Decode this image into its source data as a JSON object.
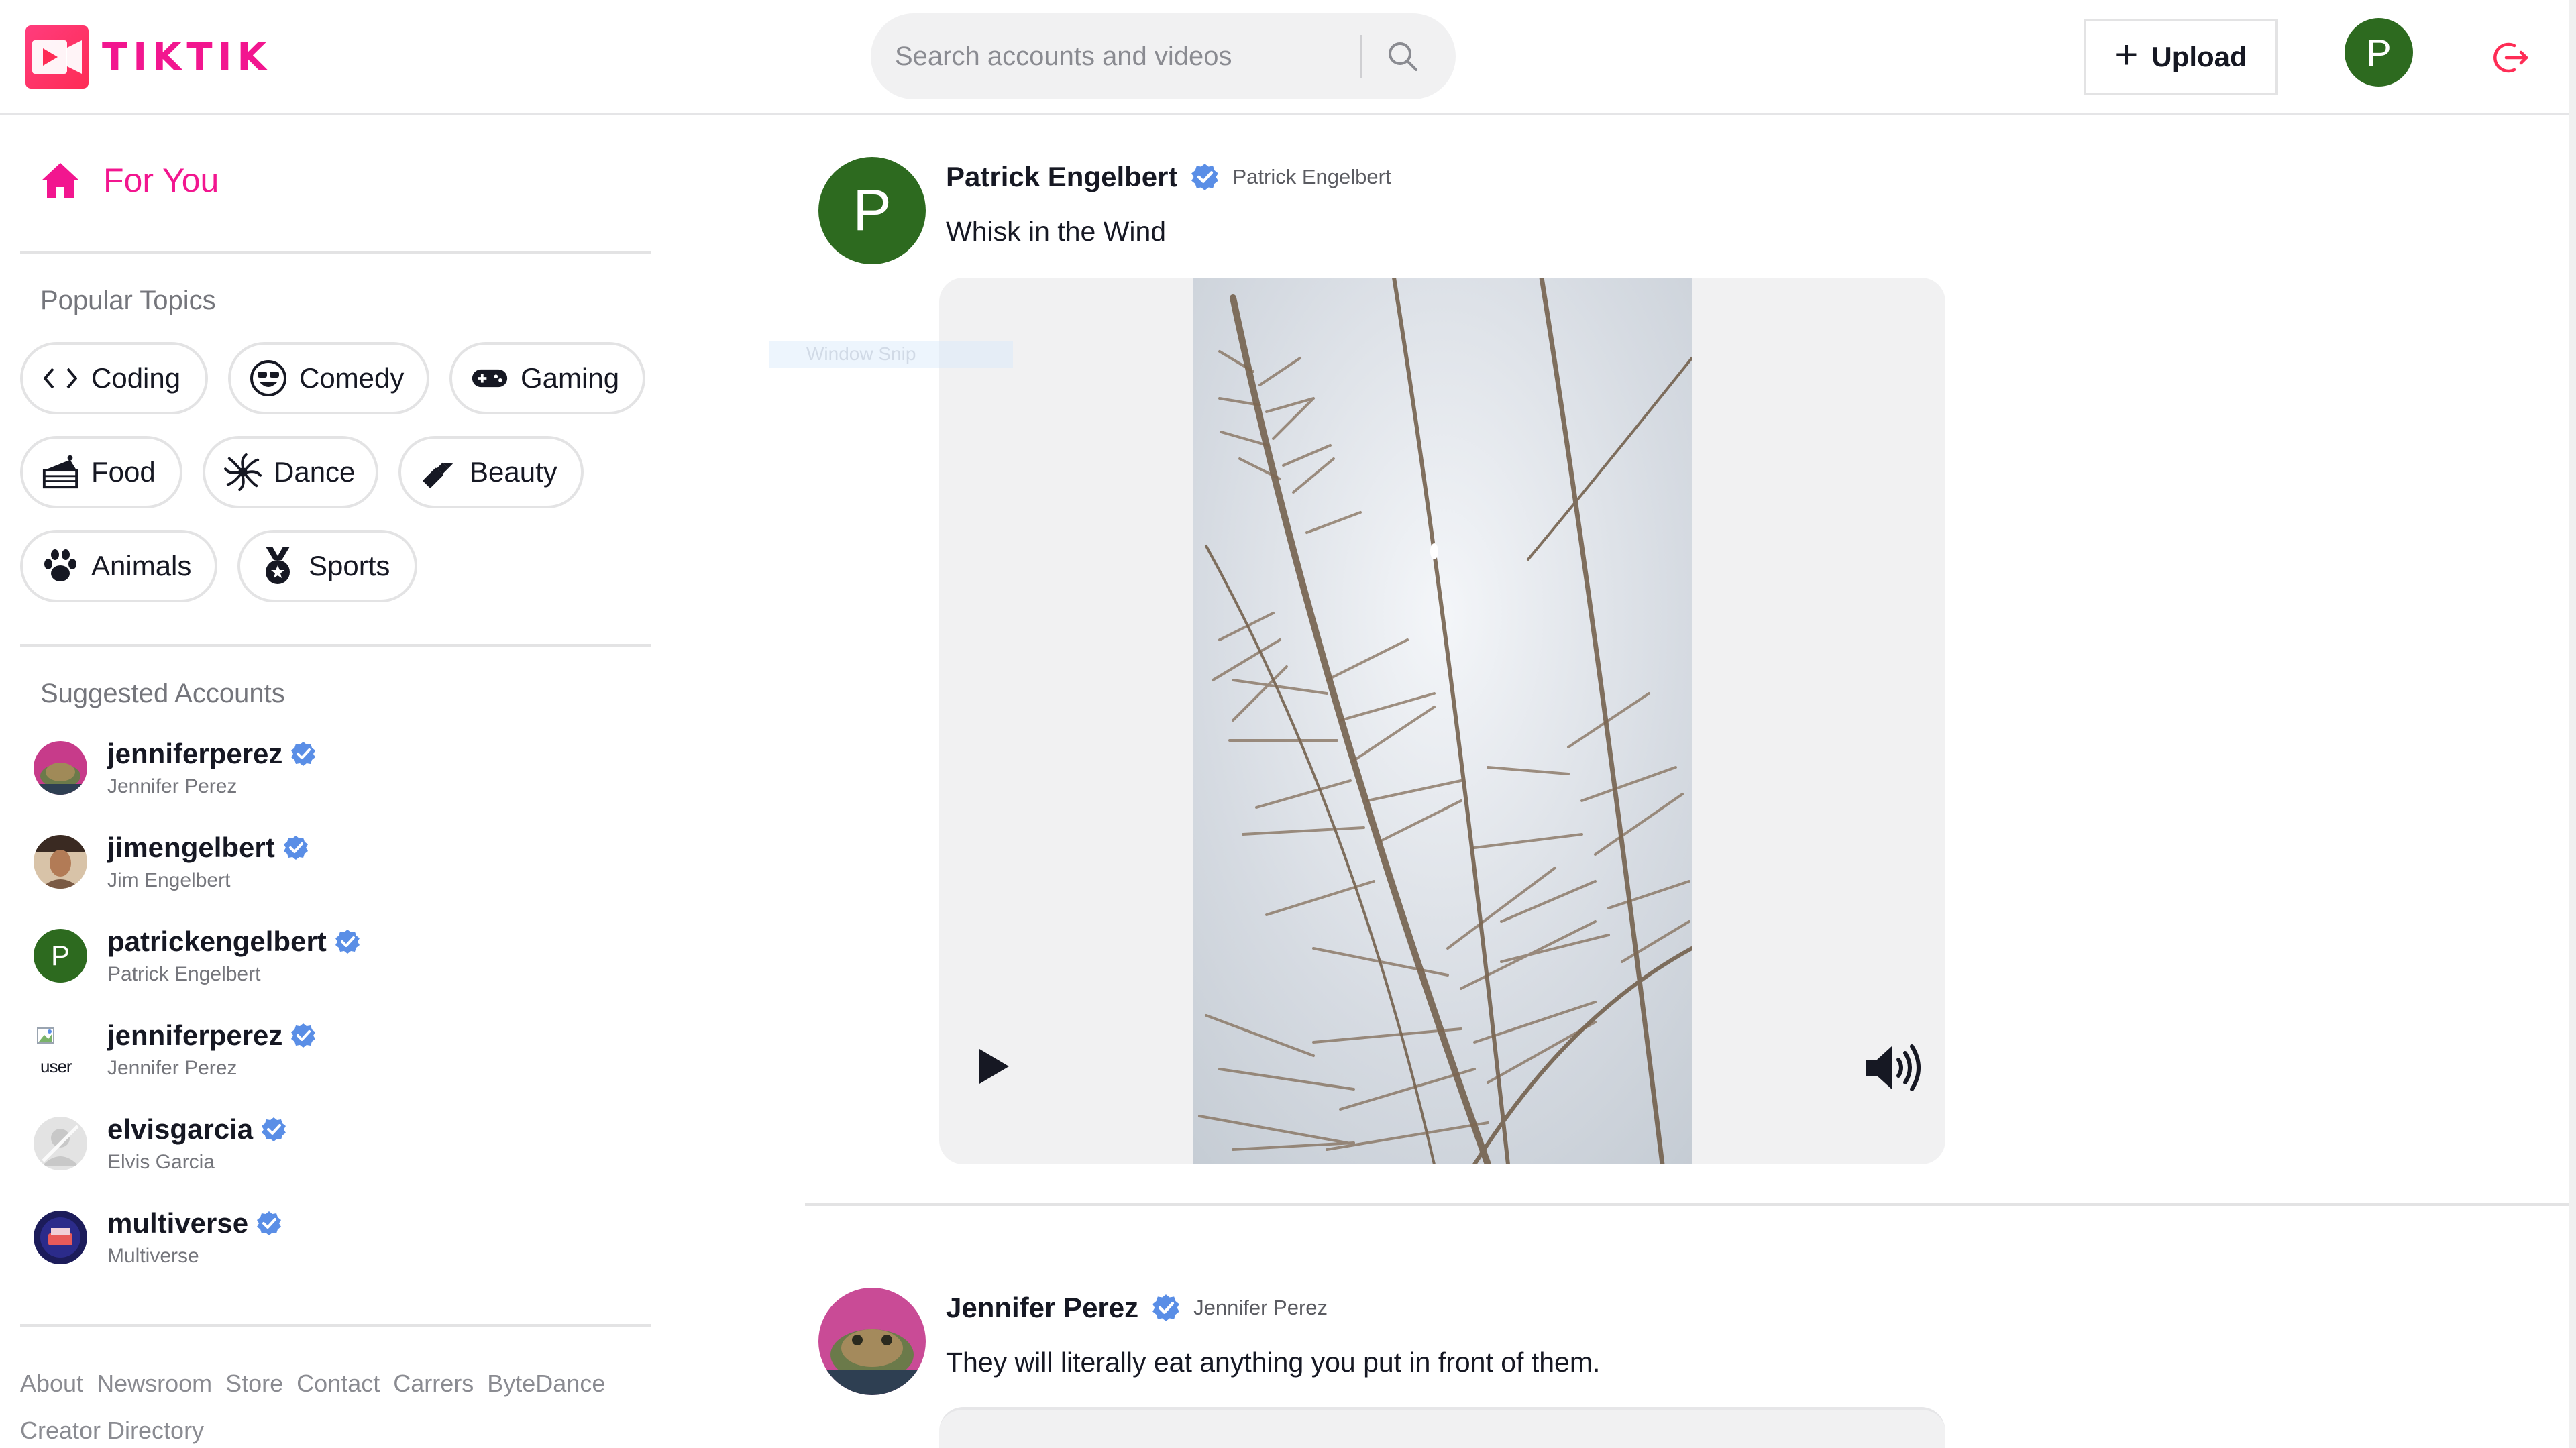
{
  "app": {
    "name": "TIKTIK",
    "brand_color": "#f2168f",
    "accent_red": "#fe2c55"
  },
  "header": {
    "search_placeholder": "Search accounts and videos",
    "upload_label": "Upload",
    "avatar_initial": "P",
    "logout_icon": "logout-icon"
  },
  "sidebar": {
    "nav": {
      "label": "For You",
      "icon": "home-icon"
    },
    "topics_title": "Popular Topics",
    "topics": [
      {
        "label": "Coding",
        "icon": "code-icon"
      },
      {
        "label": "Comedy",
        "icon": "laughing-face-icon"
      },
      {
        "label": "Gaming",
        "icon": "gamepad-icon"
      },
      {
        "label": "Food",
        "icon": "cake-icon"
      },
      {
        "label": "Dance",
        "icon": "dancer-icon"
      },
      {
        "label": "Beauty",
        "icon": "lipstick-icon"
      },
      {
        "label": "Animals",
        "icon": "paw-icon"
      },
      {
        "label": "Sports",
        "icon": "medal-icon"
      }
    ],
    "accounts_title": "Suggested Accounts",
    "accounts": [
      {
        "username": "jenniferperez",
        "name": "Jennifer Perez",
        "verified": true
      },
      {
        "username": "jimengelbert",
        "name": "Jim Engelbert",
        "verified": true
      },
      {
        "username": "patrickengelbert",
        "name": "Patrick Engelbert",
        "verified": true,
        "initial": "P"
      },
      {
        "username": "jenniferperez",
        "name": "Jennifer Perez",
        "verified": true,
        "broken_image_alt": "user"
      },
      {
        "username": "elvisgarcia",
        "name": "Elvis Garcia",
        "verified": true
      },
      {
        "username": "multiverse",
        "name": "Multiverse",
        "verified": true
      }
    ],
    "footer_links": [
      "About",
      "Newsroom",
      "Store",
      "Contact",
      "Carrers",
      "ByteDance"
    ],
    "footer_links_2": [
      "Creator Directory"
    ]
  },
  "feed": {
    "posts": [
      {
        "author": "Patrick Engelbert",
        "handle": "Patrick Engelbert",
        "verified": true,
        "avatar_initial": "P",
        "caption": "Whisk in the Wind",
        "controls": {
          "play_icon": "play-icon",
          "volume_icon": "volume-icon"
        }
      },
      {
        "author": "Jennifer Perez",
        "handle": "Jennifer Perez",
        "verified": true,
        "caption": "They will literally eat anything you put in front of them."
      }
    ]
  },
  "overlay": {
    "snip_label": "Window Snip"
  }
}
